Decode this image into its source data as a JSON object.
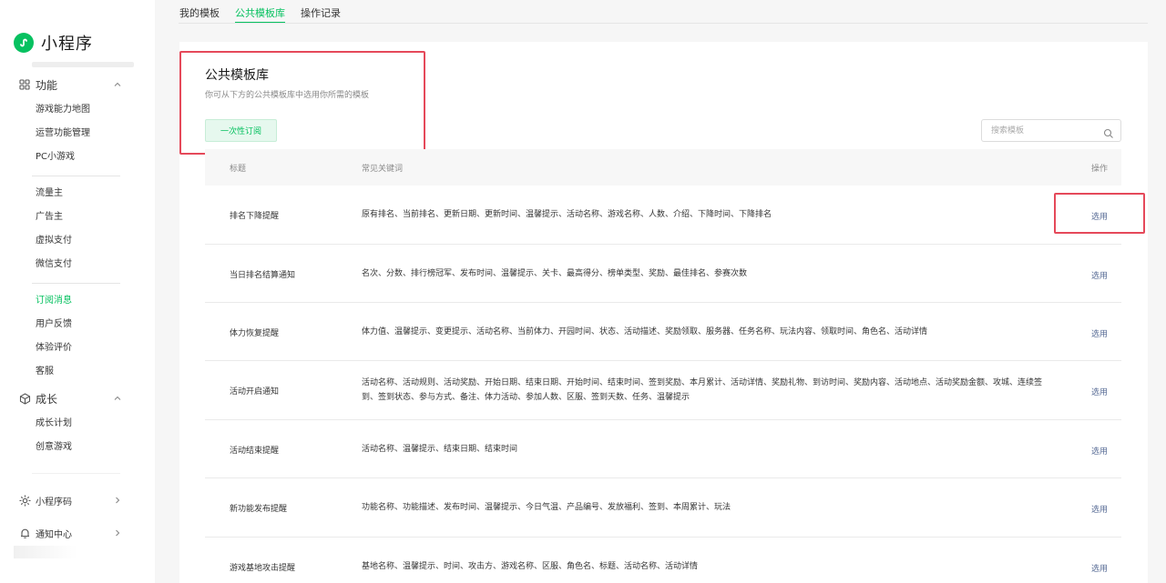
{
  "brand": {
    "name": "小程序"
  },
  "sidebar": {
    "groups": [
      {
        "label": "功能",
        "icon": "grid-icon",
        "expanded": true,
        "items": [
          "游戏能力地图",
          "运营功能管理",
          "PC小游戏",
          "流量主",
          "广告主",
          "虚拟支付",
          "微信支付",
          "订阅消息",
          "用户反馈",
          "体验评价",
          "客服"
        ]
      },
      {
        "label": "成长",
        "icon": "cube-icon",
        "expanded": true,
        "items": [
          "成长计划",
          "创意游戏"
        ]
      },
      {
        "label": "小程序码",
        "icon": "sun-icon",
        "expanded": false
      },
      {
        "label": "通知中心",
        "icon": "bell-icon",
        "expanded": false
      }
    ],
    "active_item": "订阅消息"
  },
  "tabs": [
    {
      "label": "我的模板"
    },
    {
      "label": "公共模板库",
      "active": true
    },
    {
      "label": "操作记录"
    }
  ],
  "panel": {
    "title": "公共模板库",
    "description": "你可从下方的公共模板库中选用你所需的模板",
    "once_button": "一次性订阅"
  },
  "search": {
    "placeholder": "搜索模板"
  },
  "table": {
    "headers": {
      "title": "标题",
      "keywords": "常见关键词",
      "action": "操作"
    },
    "rows": [
      {
        "title": "排名下降提醒",
        "keywords": "原有排名、当前排名、更新日期、更新时间、温馨提示、活动名称、游戏名称、人数、介绍、下降时间、下降排名",
        "action": "选用"
      },
      {
        "title": "当日排名结算通知",
        "keywords": "名次、分数、排行榜冠军、发布时间、温馨提示、关卡、最高得分、榜单类型、奖励、最佳排名、参赛次数",
        "action": "选用"
      },
      {
        "title": "体力恢复提醒",
        "keywords": "体力值、温馨提示、变更提示、活动名称、当前体力、开园时间、状态、活动描述、奖励领取、服务器、任务名称、玩法内容、领取时间、角色名、活动详情",
        "action": "选用"
      },
      {
        "title": "活动开启通知",
        "keywords": "活动名称、活动规则、活动奖励、开始日期、结束日期、开始时间、结束时间、签到奖励、本月累计、活动详情、奖励礼物、到访时间、奖励内容、活动地点、活动奖励金额、攻城、连续签到、签到状态、参与方式、备注、体力活动、参加人数、区服、签到天数、任务、温馨提示",
        "action": "选用"
      },
      {
        "title": "活动结束提醒",
        "keywords": "活动名称、温馨提示、结束日期、结束时间",
        "action": "选用"
      },
      {
        "title": "新功能发布提醒",
        "keywords": "功能名称、功能描述、发布时间、温馨提示、今日气温、产品编号、发放福利、签到、本周累计、玩法",
        "action": "选用"
      },
      {
        "title": "游戏基地攻击提醒",
        "keywords": "基地名称、温馨提示、时间、攻击方、游戏名称、区服、角色名、标题、活动名称、活动详情",
        "action": "选用"
      }
    ]
  },
  "colors": {
    "accent": "#07c160",
    "link": "#576b95",
    "highlight": "#e5495a"
  }
}
